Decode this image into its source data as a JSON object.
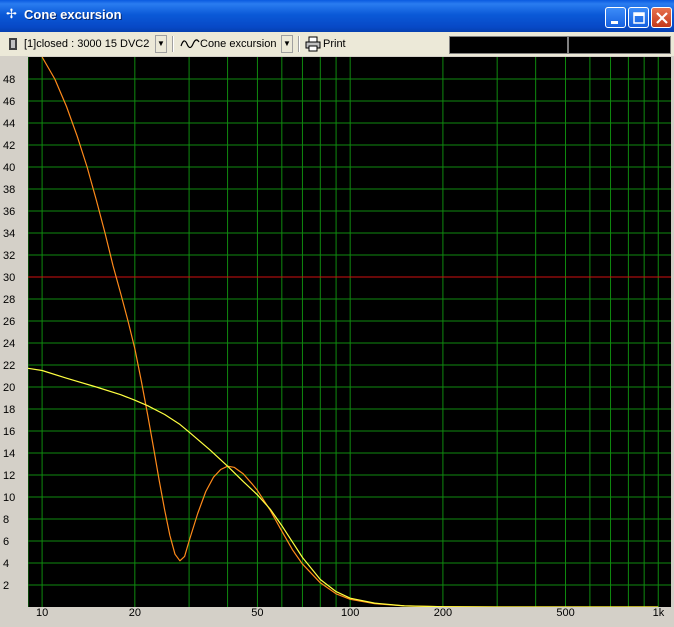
{
  "window": {
    "title": "Cone excursion"
  },
  "toolbar": {
    "project_select": "[1]closed : 3000 15 DVC2",
    "view_select": "Cone excursion",
    "print_label": "Print"
  },
  "chart_data": {
    "type": "line",
    "title": "",
    "xlabel": "",
    "ylabel": "",
    "xscale": "log",
    "xlim": [
      9,
      1100
    ],
    "ylim": [
      0,
      50
    ],
    "x_ticks": [
      10,
      20,
      50,
      100,
      200,
      500,
      1000
    ],
    "x_tick_labels": [
      "10",
      "20",
      "50",
      "100",
      "200",
      "500",
      "1k"
    ],
    "y_ticks": [
      2,
      4,
      6,
      8,
      10,
      12,
      14,
      16,
      18,
      20,
      22,
      24,
      26,
      28,
      30,
      32,
      34,
      36,
      38,
      40,
      42,
      44,
      46,
      48
    ],
    "grid": true,
    "background": "#000000",
    "grid_color": "#0f8a0f",
    "limit_line": {
      "y": 30,
      "color": "#d01010"
    },
    "series": [
      {
        "color": "#ff8a1a",
        "x": [
          10,
          11,
          12,
          13,
          14,
          15,
          16,
          17,
          18,
          19,
          20,
          21,
          22,
          23,
          24,
          25,
          26,
          27,
          28,
          29,
          30,
          32,
          34,
          36,
          38,
          40,
          42,
          45,
          48,
          50,
          55,
          60,
          65,
          70,
          80,
          90,
          100,
          120,
          150,
          200,
          300,
          500,
          1000
        ],
        "y": [
          50,
          48,
          45.5,
          42.8,
          40,
          37,
          34,
          31,
          28.5,
          26,
          23.5,
          20.5,
          17.5,
          14.5,
          11.5,
          8.8,
          6.5,
          4.8,
          4.2,
          4.6,
          6,
          8.5,
          10.5,
          11.8,
          12.5,
          12.8,
          12.7,
          12.1,
          11.2,
          10.6,
          8.8,
          6.9,
          5.2,
          3.9,
          2.2,
          1.2,
          0.7,
          0.3,
          0.1,
          0.03,
          0,
          0,
          0
        ]
      },
      {
        "color": "#ffff40",
        "x": [
          9,
          10,
          12,
          15,
          18,
          20,
          22,
          25,
          28,
          30,
          35,
          40,
          45,
          50,
          55,
          60,
          65,
          70,
          80,
          90,
          100,
          120,
          150,
          200,
          300,
          500,
          1000
        ],
        "y": [
          21.7,
          21.5,
          20.8,
          20,
          19.3,
          18.8,
          18.3,
          17.5,
          16.6,
          15.9,
          14.3,
          12.8,
          11.4,
          10.2,
          8.9,
          7.4,
          5.9,
          4.5,
          2.5,
          1.4,
          0.8,
          0.35,
          0.1,
          0.03,
          0,
          0,
          0
        ]
      }
    ]
  }
}
